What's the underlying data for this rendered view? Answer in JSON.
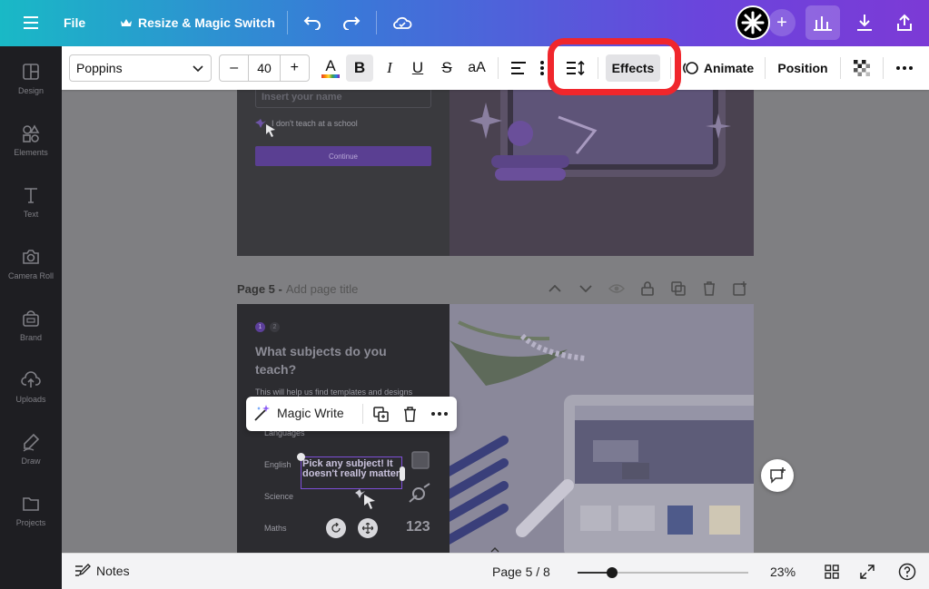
{
  "topbar": {
    "file_label": "File",
    "resize_label": "Resize & Magic Switch"
  },
  "sidebar": {
    "items": [
      {
        "label": "Design",
        "icon": "design-icon"
      },
      {
        "label": "Elements",
        "icon": "elements-icon"
      },
      {
        "label": "Text",
        "icon": "text-icon"
      },
      {
        "label": "Camera Roll",
        "icon": "camera-icon"
      },
      {
        "label": "Brand",
        "icon": "brand-icon"
      },
      {
        "label": "Uploads",
        "icon": "uploads-icon"
      },
      {
        "label": "Draw",
        "icon": "draw-icon"
      },
      {
        "label": "Projects",
        "icon": "projects-icon"
      }
    ]
  },
  "toolbar": {
    "font_family": "Poppins",
    "font_size": "40",
    "decrease_label": "–",
    "increase_label": "+",
    "text_color_label": "A",
    "bold_label": "B",
    "italic_label": "I",
    "underline_label": "U",
    "strike_label": "S",
    "case_label": "aA",
    "effects_label": "Effects",
    "animate_label": "Animate",
    "position_label": "Position"
  },
  "canvas": {
    "page4": {
      "input_placeholder": "Insert your name",
      "checkbox_text": "I don't teach at a school",
      "continue_label": "Continue"
    },
    "page5": {
      "page_label": "Page 5 -",
      "add_title": "Add page title",
      "steps": [
        "1",
        "2"
      ],
      "heading": "What subjects do you teach?",
      "subtext": "This will help us find templates and designs",
      "languages": "Languages",
      "english": "English",
      "science": "Science",
      "maths": "Maths",
      "selected_text": "Pick any subject! It doesn't really matter"
    }
  },
  "float_menu": {
    "magic_write_label": "Magic Write"
  },
  "bottombar": {
    "notes_label": "Notes",
    "page_indicator": "Page 5 / 8",
    "zoom_label": "23%",
    "zoom_level": 0.2
  },
  "colors": {
    "highlight": "#f0262c",
    "topbar_start": "#19b9c6",
    "topbar_end": "#7c3ad6"
  }
}
